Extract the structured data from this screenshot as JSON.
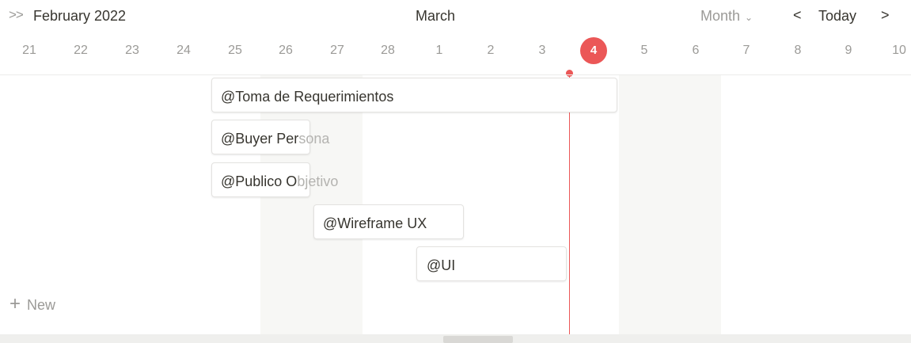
{
  "header": {
    "collapse_glyph": ">>",
    "current_month": "February 2022",
    "next_month": "March",
    "view_mode": "Month",
    "today_label": "Today",
    "prev_glyph": "<",
    "next_glyph": ">"
  },
  "days": [
    {
      "label": "21"
    },
    {
      "label": "22"
    },
    {
      "label": "23"
    },
    {
      "label": "24"
    },
    {
      "label": "25"
    },
    {
      "label": "26"
    },
    {
      "label": "27"
    },
    {
      "label": "28"
    },
    {
      "label": "1"
    },
    {
      "label": "2"
    },
    {
      "label": "3"
    },
    {
      "label": "4",
      "today": true
    },
    {
      "label": "5"
    },
    {
      "label": "6"
    },
    {
      "label": "7"
    },
    {
      "label": "8"
    },
    {
      "label": "9"
    },
    {
      "label": "10"
    }
  ],
  "tasks": [
    {
      "label": "@Toma de Requerimientos",
      "overflow": ""
    },
    {
      "label": "@Buyer Per",
      "overflow": "sona"
    },
    {
      "label": "@Publico O",
      "overflow": "bjetivo"
    },
    {
      "label": "@Wireframe UX",
      "overflow": ""
    },
    {
      "label": "@UI",
      "overflow": ""
    }
  ],
  "new_label": "New",
  "colors": {
    "today_accent": "#eb5757",
    "weekend_shade": "#f7f7f5",
    "text_primary": "#37352f",
    "text_muted": "#9b9a97"
  }
}
